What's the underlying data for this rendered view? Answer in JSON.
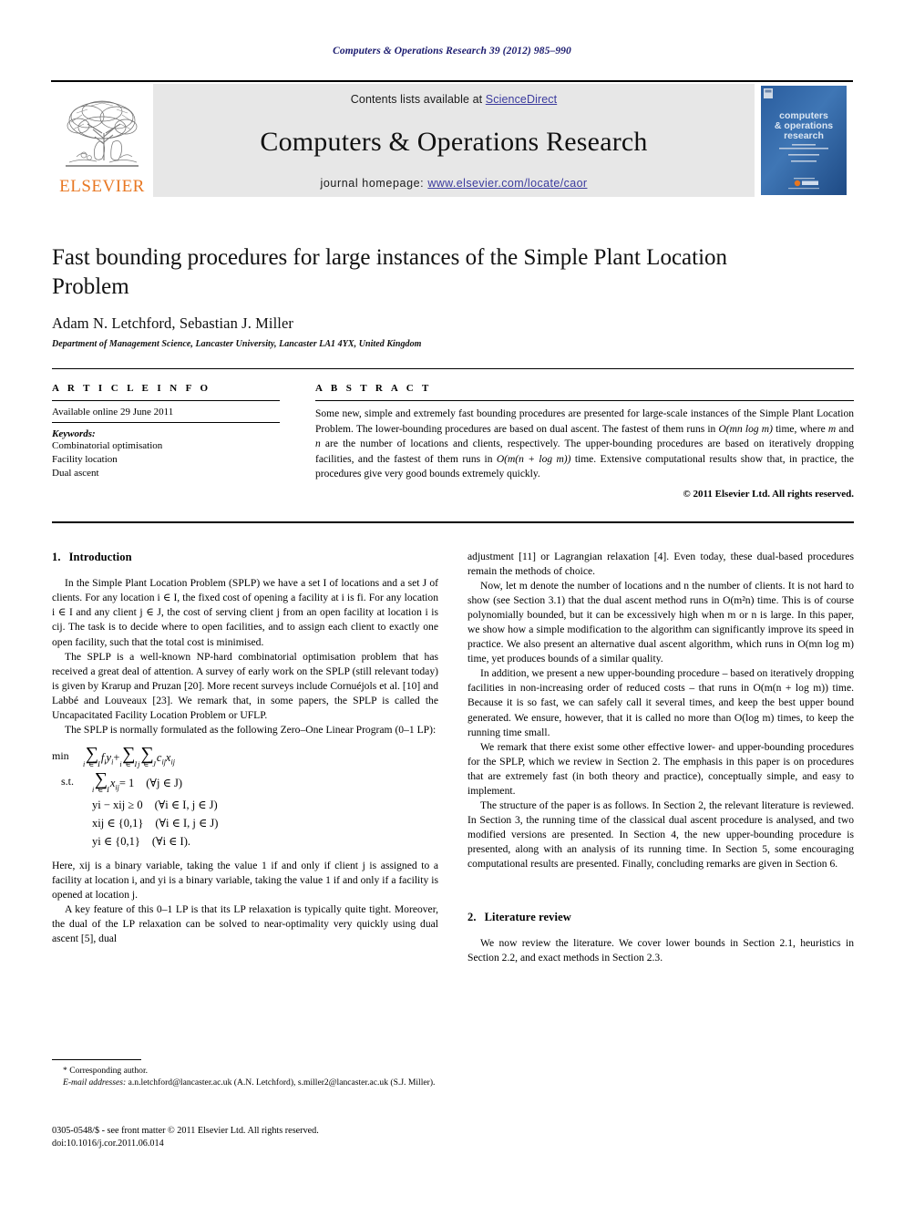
{
  "running_head": "Computers & Operations Research 39 (2012) 985–990",
  "masthead": {
    "contents_prefix": "Contents lists available at ",
    "sciencedirect": "ScienceDirect",
    "journal_name": "Computers & Operations Research",
    "homepage_prefix": "journal homepage: ",
    "homepage_url": "www.elsevier.com/locate/caor",
    "publisher": "ELSEVIER",
    "cover_title_line1": "computers",
    "cover_title_line2": "& operations",
    "cover_title_line3": "research",
    "link_color": "#3b3b9e",
    "band_color": "#e7e7e7",
    "elsevier_orange": "#E87722"
  },
  "article": {
    "title": "Fast bounding procedures for large instances of the Simple Plant Location Problem",
    "authors": "Adam N. Letchford, Sebastian J. Miller",
    "corresponding_marker": "*",
    "affiliation": "Department of Management Science, Lancaster University, Lancaster LA1 4YX, United Kingdom"
  },
  "article_info": {
    "heading": "A R T I C L E    I N F O",
    "available_online": "Available online 29 June 2011",
    "keywords_label": "Keywords:",
    "keywords": [
      "Combinatorial optimisation",
      "Facility location",
      "Dual ascent"
    ]
  },
  "abstract": {
    "heading": "A B S T R A C T",
    "text_parts": [
      "Some new, simple and extremely fast bounding procedures are presented for large-scale instances of the Simple Plant Location Problem. The lower-bounding procedures are based on dual ascent. The fastest of them runs in ",
      "O(mn log m)",
      " time, where ",
      "m",
      " and ",
      "n",
      " are the number of locations and clients, respectively. The upper-bounding procedures are based on iteratively dropping facilities, and the fastest of them runs in ",
      "O(m(n + log m))",
      " time. Extensive computational results show that, in practice, the procedures give very good bounds extremely quickly."
    ],
    "copyright": "© 2011 Elsevier Ltd. All rights reserved."
  },
  "sections": {
    "intro": {
      "number": "1.",
      "title": "Introduction"
    },
    "literature": {
      "number": "2.",
      "title": "Literature review"
    }
  },
  "left_column": {
    "p1": "In the Simple Plant Location Problem (SPLP) we have a set I of locations and a set J of clients. For any location i ∈ I, the fixed cost of opening a facility at i is fi. For any location i ∈ I and any client j ∈ J, the cost of serving client j from an open facility at location i is cij. The task is to decide where to open facilities, and to assign each client to exactly one open facility, such that the total cost is minimised.",
    "p2": "The SPLP is a well-known NP-hard combinatorial optimisation problem that has received a great deal of attention. A survey of early work on the SPLP (still relevant today) is given by Krarup and Pruzan [20]. More recent surveys include Cornuéjols et al. [10] and Labbé and Louveaux [23]. We remark that, in some papers, the SPLP is called the Uncapacitated Facility Location Problem or UFLP.",
    "p3": "The SPLP is normally formulated as the following Zero–One Linear Program (0–1 LP):",
    "math": {
      "min_label": "min",
      "st_label": "s.t.",
      "objective_sum1_limits": "i ∈ I",
      "objective_term1": "fiyi",
      "plus": "+",
      "objective_sum2_limits": "i ∈ I",
      "objective_sum3_limits": "j ∈ J",
      "objective_term2": "cijxij",
      "constraint1_sum_limits": "i ∈ I",
      "constraint1_lhs": "xij",
      "constraint1_rhs": "= 1",
      "constraint1_cond": "(∀j ∈ J)",
      "constraint2": "yi − xij ≥ 0",
      "constraint2_cond": "(∀i ∈ I, j ∈ J)",
      "constraint3": "xij ∈ {0,1}",
      "constraint3_cond": "(∀i ∈ I, j ∈ J)",
      "constraint4": "yi ∈ {0,1}",
      "constraint4_cond": "(∀i ∈ I)."
    },
    "p4": "Here, xij is a binary variable, taking the value 1 if and only if client j is assigned to a facility at location i, and yi is a binary variable, taking the value 1 if and only if a facility is opened at location j.",
    "p5": "A key feature of this 0–1 LP is that its LP relaxation is typically quite tight. Moreover, the dual of the LP relaxation can be solved to near-optimality very quickly using dual ascent [5], dual"
  },
  "right_column": {
    "p1": "adjustment [11] or Lagrangian relaxation [4]. Even today, these dual-based procedures remain the methods of choice.",
    "p2": "Now, let m denote the number of locations and n the number of clients. It is not hard to show (see Section 3.1) that the dual ascent method runs in O(m²n) time. This is of course polynomially bounded, but it can be excessively high when m or n is large. In this paper, we show how a simple modification to the algorithm can significantly improve its speed in practice. We also present an alternative dual ascent algorithm, which runs in O(mn log m) time, yet produces bounds of a similar quality.",
    "p3": "In addition, we present a new upper-bounding procedure – based on iteratively dropping facilities in non-increasing order of reduced costs – that runs in O(m(n + log m)) time. Because it is so fast, we can safely call it several times, and keep the best upper bound generated. We ensure, however, that it is called no more than O(log m) times, to keep the running time small.",
    "p4": "We remark that there exist some other effective lower- and upper-bounding procedures for the SPLP, which we review in Section 2. The emphasis in this paper is on procedures that are extremely fast (in both theory and practice), conceptually simple, and easy to implement.",
    "p5": "The structure of the paper is as follows. In Section 2, the relevant literature is reviewed. In Section 3, the running time of the classical dual ascent procedure is analysed, and two modified versions are presented. In Section 4, the new upper-bounding procedure is presented, along with an analysis of its running time. In Section 5, some encouraging computational results are presented. Finally, concluding remarks are given in Section 6.",
    "p6": "We now review the literature. We cover lower bounds in Section 2.1, heuristics in Section 2.2, and exact methods in Section 2.3."
  },
  "footnote": {
    "corresponding": "Corresponding author.",
    "email_label": "E-mail addresses:",
    "email1": "a.n.letchford@lancaster.ac.uk (A.N. Letchford),",
    "email2": "s.miller2@lancaster.ac.uk (S.J. Miller)."
  },
  "imprint": {
    "line1": "0305-0548/$ - see front matter © 2011 Elsevier Ltd. All rights reserved.",
    "line2": "doi:10.1016/j.cor.2011.06.014"
  }
}
